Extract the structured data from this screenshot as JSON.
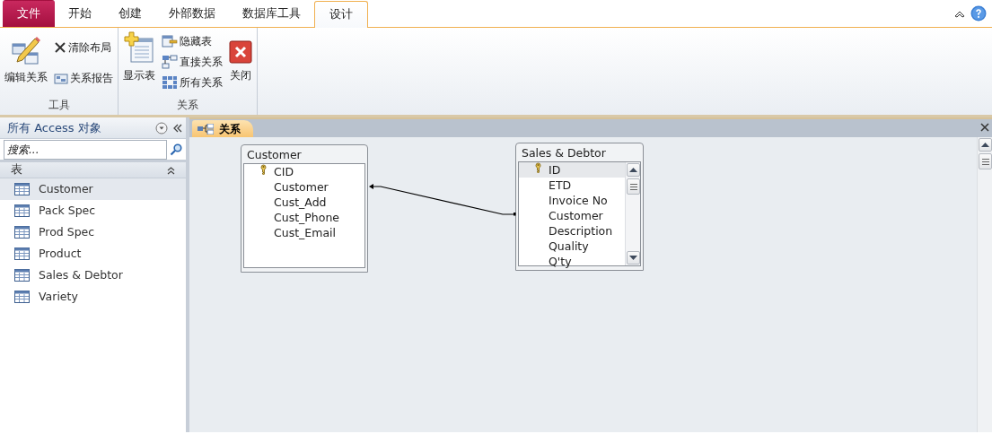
{
  "ribbon_tabs": [
    {
      "label": "文件",
      "kind": "file",
      "selected": false
    },
    {
      "label": "开始",
      "kind": "tab",
      "selected": false
    },
    {
      "label": "创建",
      "kind": "tab",
      "selected": false
    },
    {
      "label": "外部数据",
      "kind": "tab",
      "selected": false
    },
    {
      "label": "数据库工具",
      "kind": "tab",
      "selected": false
    },
    {
      "label": "设计",
      "kind": "tab",
      "selected": true
    }
  ],
  "ribbon_groups": [
    {
      "label": "工具",
      "buttons": [
        {
          "label": "编辑关系",
          "kind": "large"
        },
        {
          "label": "清除布局",
          "kind": "small"
        },
        {
          "label": "关系报告",
          "kind": "small"
        }
      ]
    },
    {
      "label": "关系",
      "buttons": [
        {
          "label": "显示表",
          "kind": "large"
        },
        {
          "label": "隐藏表",
          "kind": "small"
        },
        {
          "label": "直接关系",
          "kind": "small"
        },
        {
          "label": "所有关系",
          "kind": "small"
        },
        {
          "label": "关闭",
          "kind": "large"
        }
      ]
    }
  ],
  "navigation_pane": {
    "title": "所有 Access 对象",
    "search": {
      "placeholder": "搜索..."
    },
    "section": {
      "label": "表",
      "expanded": true
    },
    "items": [
      {
        "label": "Customer",
        "selected": true
      },
      {
        "label": "Pack Spec",
        "selected": false
      },
      {
        "label": "Prod Spec",
        "selected": false
      },
      {
        "label": "Product",
        "selected": false
      },
      {
        "label": "Sales & Debtor",
        "selected": false
      },
      {
        "label": "Variety",
        "selected": false
      }
    ]
  },
  "document_tabs": [
    {
      "label": "关系",
      "selected": true
    }
  ],
  "tables": [
    {
      "title": "Customer",
      "scrollable": false,
      "fields": [
        {
          "name": "CID",
          "primary_key": true,
          "selected": false
        },
        {
          "name": "Customer",
          "primary_key": false,
          "selected": false
        },
        {
          "name": "Cust_Add",
          "primary_key": false,
          "selected": false
        },
        {
          "name": "Cust_Phone",
          "primary_key": false,
          "selected": false
        },
        {
          "name": "Cust_Email",
          "primary_key": false,
          "selected": false
        }
      ]
    },
    {
      "title": "Sales & Debtor",
      "scrollable": true,
      "fields": [
        {
          "name": "ID",
          "primary_key": true,
          "selected": true
        },
        {
          "name": "ETD",
          "primary_key": false,
          "selected": false
        },
        {
          "name": "Invoice No",
          "primary_key": false,
          "selected": false
        },
        {
          "name": "Customer",
          "primary_key": false,
          "selected": false
        },
        {
          "name": "Description",
          "primary_key": false,
          "selected": false
        },
        {
          "name": "Quality",
          "primary_key": false,
          "selected": false
        },
        {
          "name": "Q'ty",
          "primary_key": false,
          "selected": false
        }
      ]
    }
  ]
}
